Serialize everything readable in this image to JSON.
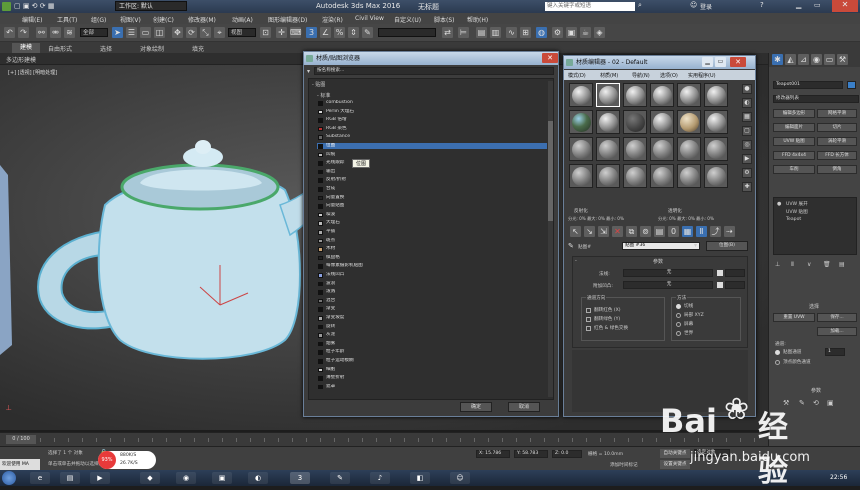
{
  "window": {
    "workspace_label": "工作区: 默认",
    "title": "Autodesk 3ds Max 2016",
    "doc_name": "无标题",
    "search_placeholder": "键入关键字或短语",
    "login": "登录"
  },
  "menu": [
    "编辑(E)",
    "工具(T)",
    "组(G)",
    "视图(V)",
    "创建(C)",
    "修改器(M)",
    "动画(A)",
    "图形编辑器(D)",
    "渲染(R)",
    "Civil View",
    "自定义(U)",
    "脚本(S)",
    "帮助(H)"
  ],
  "toolbar": {
    "selection_filter": "全部",
    "ref_coord": "视图"
  },
  "ribbon": {
    "tabs": [
      "建模",
      "自由形式",
      "选择",
      "对象绘制",
      "填充"
    ],
    "sub_label": "多边形建模"
  },
  "viewport": {
    "label": "[+] [透视] [明暗处理]"
  },
  "material_browser": {
    "title": "材质/贴图浏览器",
    "search_placeholder": "按名称搜索...",
    "section_maps": "- 贴图",
    "section_standard": "- 标准",
    "tooltip": "位图",
    "ok": "确定",
    "cancel": "取消",
    "items": [
      "combustion",
      "Perlin 大理石",
      "RGB 倍增",
      "RGB 染色",
      "Substance",
      "位图",
      "凹痕",
      "光线跟踪",
      "输出",
      "反射/折射",
      "合成",
      "向量置换",
      "向量贴图",
      "噪波",
      "大理石",
      "平铺",
      "斑点",
      "木材",
      "棋盘格",
      "每像素摄影机贴图",
      "法线凹凸",
      "波浪",
      "泼溅",
      "混合",
      "渐变",
      "渐变坡度",
      "旋转",
      "灰泥",
      "烟雾",
      "粒子年龄",
      "粒子运动模糊",
      "细胞",
      "薄壁折射",
      "遮罩"
    ],
    "selected_index": 5
  },
  "material_editor": {
    "title": "材质编辑器 - 02 - Default",
    "menu": [
      "模式(D)",
      "材质(M)",
      "导航(N)",
      "选项(O)",
      "实用程序(U)"
    ],
    "reflect_label": "反射化",
    "refract_label": "透明化",
    "row1": "分光: 0%   最大: 0%   最小: 0%",
    "row2": "分光: 0%   最大: 0%   最小: 0%",
    "map_label": "贴图#",
    "map_value": "贴图 #36",
    "map_type": "位图(B)",
    "rollout_title": "参数",
    "color_label": "法线:",
    "color_value": "无",
    "bump_label": "附加凹凸:",
    "bump_value": "无",
    "channel_group": "通道方向",
    "channel_items": [
      "翻转红色 (X)",
      "翻转绿色 (Y)",
      "红色 & 绿色交换"
    ],
    "method_group": "方法",
    "method_items": [
      "切线",
      "局部 XYZ",
      "屏幕",
      "世界"
    ]
  },
  "command_panel": {
    "object_name": "Teapot001",
    "modifier_list": "修改器列表",
    "buttons_left": [
      "编辑多边形",
      "编辑面片",
      "UVW 贴图",
      "FFD 4x4x4",
      "车削"
    ],
    "buttons_right": [
      "网格平滑",
      "切片",
      "涡轮平滑",
      "FFD 长方体",
      "倒角"
    ],
    "stack": [
      "UVW 展开",
      "UVW 贴图",
      "Teapot"
    ],
    "section_selection": "选择",
    "reset_uvw": "重置 UVW",
    "save": "保存...",
    "load": "加载...",
    "channel_label": "通道:",
    "map_channel": "贴图通道",
    "vertex_color": "顶点颜色通道",
    "channel_value": "1",
    "section_params": "参数"
  },
  "timeline": {
    "frame": "0 / 100"
  },
  "status": {
    "selection": "选择了 1 个 对象",
    "hint": "单击或单击并拖动以选择对象",
    "x": "X: 15.786",
    "y": "Y: 58.783",
    "z": "Z: 0.0",
    "grid": "栅格 = 10.0mm",
    "auto_key": "自动关键点",
    "set_key": "设置关键点",
    "selected": "选定对象",
    "add_time_tag": "添加时间标记",
    "mode": "欢迎使用 MA",
    "pct": "93%",
    "net_up": "880K/S",
    "net_down": "26.7K/S"
  },
  "taskbar": {
    "clock": "22:56"
  },
  "watermark": {
    "brand": "Bai",
    "paw": "du",
    "cn": "经验",
    "url": "jingyan.baidu.com"
  }
}
